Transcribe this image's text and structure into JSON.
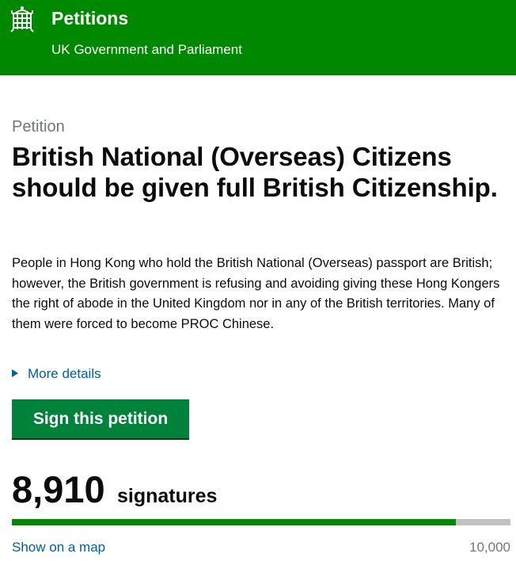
{
  "header": {
    "title": "Petitions",
    "subtitle": "UK Government and Parliament",
    "logo_icon": "portcullis-icon",
    "background_color": "#008800"
  },
  "petition": {
    "label": "Petition",
    "title": "British National (Overseas) Citizens should be given full British Citizenship.",
    "description": "People in Hong Kong who hold the British National (Overseas) passport are British; however, the British government is refusing and avoiding giving these Hong Kongers the right of abode in the United Kingdom nor in any of the British territories. Many of them were forced to become PROC Chinese.",
    "more_details_label": "More details",
    "more_details_icon": "triangle-right-icon",
    "sign_button_label": "Sign this petition",
    "button_color": "#00823b"
  },
  "signatures": {
    "count": "8,910",
    "label": "signatures",
    "progress_fraction": 0.891,
    "target": "10,000",
    "map_link_label": "Show on a map",
    "progress_color": "#008800",
    "link_color": "#005ea5"
  }
}
